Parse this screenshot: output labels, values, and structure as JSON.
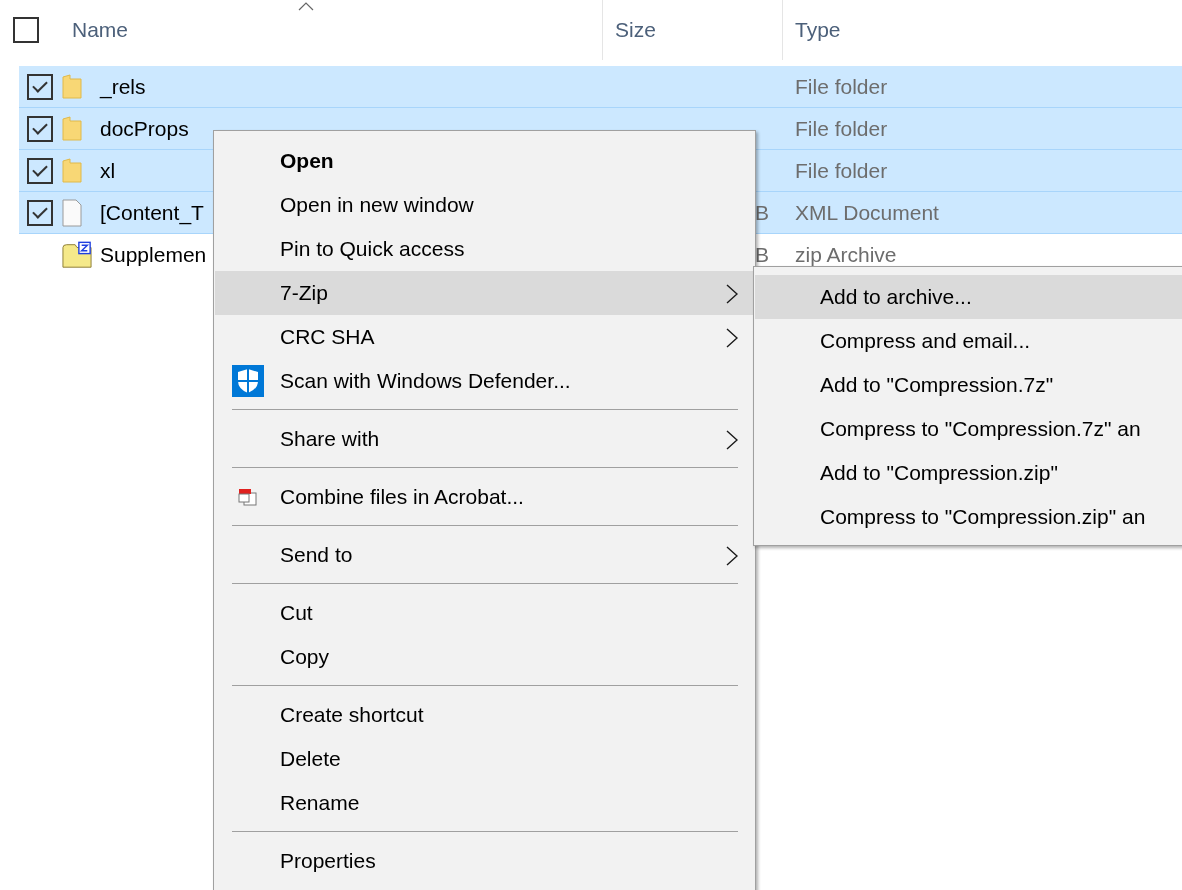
{
  "select_all": {
    "checked": false
  },
  "columns": [
    {
      "label": "Name",
      "sorted": true
    },
    {
      "label": "Size",
      "sorted": false
    },
    {
      "label": "Type",
      "sorted": false
    }
  ],
  "rows": [
    {
      "name": "_rels",
      "size": "",
      "type": "File folder",
      "kind": "folder",
      "checked": true,
      "selected": true
    },
    {
      "name": "docProps",
      "size": "",
      "type": "File folder",
      "kind": "folder",
      "checked": true,
      "selected": true
    },
    {
      "name": "xl",
      "size": "",
      "type": "File folder",
      "kind": "folder",
      "checked": true,
      "selected": true
    },
    {
      "name": "[Content_T",
      "size": "B",
      "type": "XML Document",
      "kind": "file",
      "checked": true,
      "selected": true
    },
    {
      "name": "Supplemen",
      "size": "B",
      "type": "zip Archive",
      "kind": "archive",
      "checked": false,
      "selected": false
    }
  ],
  "context_menu": {
    "items": [
      {
        "kind": "item",
        "label": "Open",
        "default": true,
        "submenu": false,
        "highlighted": false
      },
      {
        "kind": "item",
        "label": "Open in new window",
        "default": false,
        "submenu": false,
        "highlighted": false
      },
      {
        "kind": "item",
        "label": "Pin to Quick access",
        "default": false,
        "submenu": false,
        "highlighted": false
      },
      {
        "kind": "item",
        "label": "7-Zip",
        "default": false,
        "submenu": true,
        "highlighted": true
      },
      {
        "kind": "item",
        "label": "CRC SHA",
        "default": false,
        "submenu": true,
        "highlighted": false
      },
      {
        "kind": "shield",
        "label": "Scan with Windows Defender...",
        "default": false,
        "submenu": false,
        "highlighted": false
      },
      {
        "kind": "separator"
      },
      {
        "kind": "item",
        "label": "Share with",
        "default": false,
        "submenu": true,
        "highlighted": false
      },
      {
        "kind": "separator"
      },
      {
        "kind": "documents",
        "label": "Combine files in Acrobat...",
        "default": false,
        "submenu": false,
        "highlighted": false
      },
      {
        "kind": "separator"
      },
      {
        "kind": "item",
        "label": "Send to",
        "default": false,
        "submenu": true,
        "highlighted": false
      },
      {
        "kind": "separator"
      },
      {
        "kind": "item",
        "label": "Cut",
        "default": false,
        "submenu": false,
        "highlighted": false
      },
      {
        "kind": "item",
        "label": "Copy",
        "default": false,
        "submenu": false,
        "highlighted": false
      },
      {
        "kind": "separator"
      },
      {
        "kind": "item",
        "label": "Create shortcut",
        "default": false,
        "submenu": false,
        "highlighted": false
      },
      {
        "kind": "item",
        "label": "Delete",
        "default": false,
        "submenu": false,
        "highlighted": false
      },
      {
        "kind": "item",
        "label": "Rename",
        "default": false,
        "submenu": false,
        "highlighted": false
      },
      {
        "kind": "separator"
      },
      {
        "kind": "item",
        "label": "Properties",
        "default": false,
        "submenu": false,
        "highlighted": false
      }
    ]
  },
  "submenu": {
    "items": [
      {
        "label": "Add to archive...",
        "highlighted": true
      },
      {
        "label": "Compress and email...",
        "highlighted": false
      },
      {
        "label": "Add to \"Compression.7z\"",
        "highlighted": false
      },
      {
        "label": "Compress to \"Compression.7z\" an",
        "highlighted": false
      },
      {
        "label": "Add to \"Compression.zip\"",
        "highlighted": false
      },
      {
        "label": "Compress to \"Compression.zip\" an",
        "highlighted": false
      }
    ]
  }
}
